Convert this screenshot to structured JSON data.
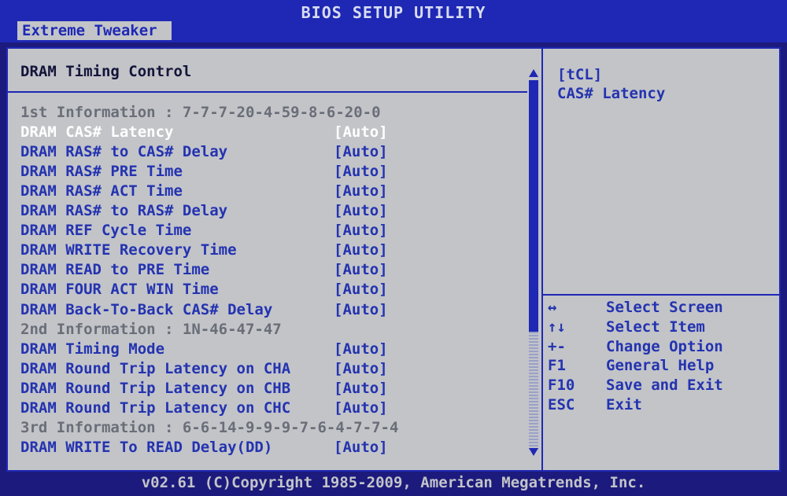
{
  "window": {
    "title": "BIOS SETUP UTILITY",
    "active_menu": "Extreme Tweaker",
    "copyright": "v02.61 (C)Copyright 1985-2009, American Megatrends, Inc."
  },
  "section": {
    "title": "DRAM Timing Control"
  },
  "rows": [
    {
      "label": "1st Information : 7-7-7-20-4-59-8-6-20-0",
      "value": "",
      "type": "info"
    },
    {
      "label": "DRAM CAS# Latency",
      "value": "[Auto]",
      "type": "selected"
    },
    {
      "label": "DRAM RAS# to CAS# Delay",
      "value": "[Auto]",
      "type": "setting"
    },
    {
      "label": "DRAM RAS# PRE Time",
      "value": "[Auto]",
      "type": "setting"
    },
    {
      "label": "DRAM RAS# ACT Time",
      "value": "[Auto]",
      "type": "setting"
    },
    {
      "label": "DRAM RAS# to RAS# Delay",
      "value": "[Auto]",
      "type": "setting"
    },
    {
      "label": "DRAM REF Cycle Time",
      "value": "[Auto]",
      "type": "setting"
    },
    {
      "label": "DRAM WRITE Recovery Time",
      "value": "[Auto]",
      "type": "setting"
    },
    {
      "label": "DRAM READ to PRE Time",
      "value": "[Auto]",
      "type": "setting"
    },
    {
      "label": "DRAM FOUR ACT WIN Time",
      "value": "[Auto]",
      "type": "setting"
    },
    {
      "label": "DRAM Back-To-Back CAS# Delay",
      "value": "[Auto]",
      "type": "setting"
    },
    {
      "label": "2nd Information : 1N-46-47-47",
      "value": "",
      "type": "info"
    },
    {
      "label": "DRAM Timing Mode",
      "value": "[Auto]",
      "type": "setting"
    },
    {
      "label": "DRAM Round Trip Latency on CHA",
      "value": "[Auto]",
      "type": "setting"
    },
    {
      "label": "DRAM Round Trip Latency on CHB",
      "value": "[Auto]",
      "type": "setting"
    },
    {
      "label": "DRAM Round Trip Latency on CHC",
      "value": "[Auto]",
      "type": "setting"
    },
    {
      "label": "3rd Information : 6-6-14-9-9-9-7-6-4-7-7-4",
      "value": "",
      "type": "info"
    },
    {
      "label": "DRAM WRITE To READ Delay(DD)",
      "value": "[Auto]",
      "type": "setting"
    }
  ],
  "help": {
    "line1": "[tCL]",
    "line2": "CAS# Latency"
  },
  "keys": [
    {
      "key": "↔",
      "desc": "Select Screen"
    },
    {
      "key": "↑↓",
      "desc": "Select Item"
    },
    {
      "key": "+-",
      "desc": "Change Option"
    },
    {
      "key": "F1",
      "desc": "General Help"
    },
    {
      "key": "F10",
      "desc": "Save and Exit"
    },
    {
      "key": "ESC",
      "desc": "Exit"
    }
  ],
  "colors": {
    "background": "#1c1a7c",
    "panel": "#c2c4c8",
    "accent_blue": "#2433b0",
    "info_gray": "#6a6e78",
    "selected_white": "#ffffff"
  }
}
